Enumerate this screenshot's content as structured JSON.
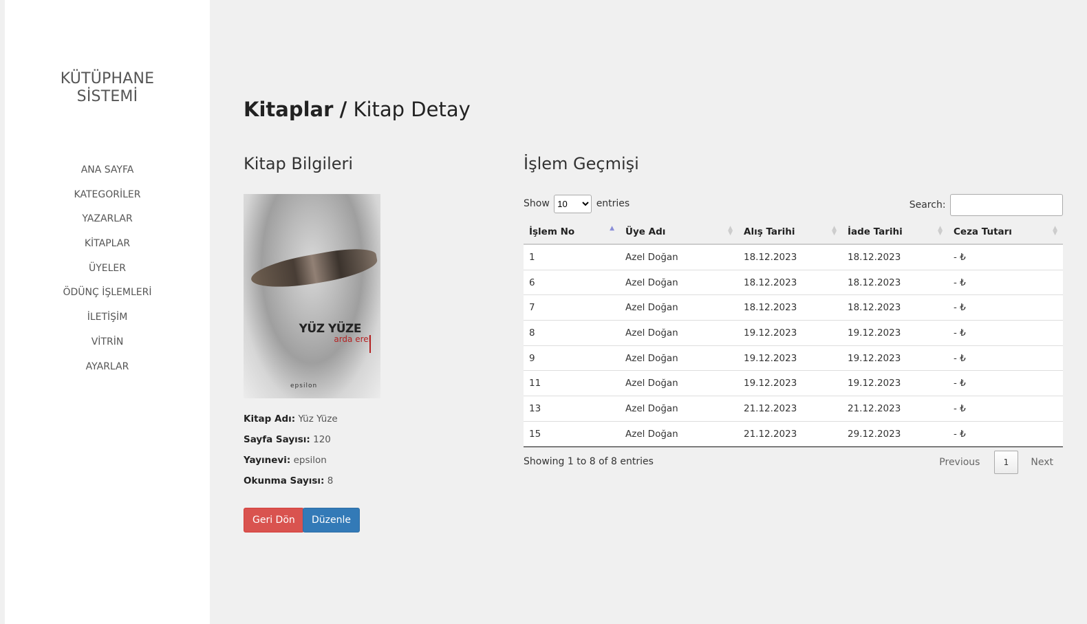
{
  "sidebar": {
    "brand_line1": "KÜTÜPHANE",
    "brand_line2": "SİSTEMİ",
    "items": [
      {
        "label": "ANA SAYFA"
      },
      {
        "label": "KATEGORİLER"
      },
      {
        "label": "YAZARLAR"
      },
      {
        "label": "KİTAPLAR"
      },
      {
        "label": "ÜYELER"
      },
      {
        "label": "ÖDÜNÇ İŞLEMLERİ"
      },
      {
        "label": "İLETİŞİM"
      },
      {
        "label": "VİTRİN"
      },
      {
        "label": "AYARLAR"
      }
    ]
  },
  "header": {
    "breadcrumb_root": "Kitaplar",
    "separator": "/",
    "breadcrumb_current": "Kitap Detay"
  },
  "book": {
    "section_title": "Kitap Bilgileri",
    "cover": {
      "title": "YÜZ YÜZE",
      "author": "arda erel",
      "publisher_logo": "epsilon"
    },
    "fields": [
      {
        "label": "Kitap Adı:",
        "value": "Yüz Yüze"
      },
      {
        "label": "Sayfa Sayısı:",
        "value": "120"
      },
      {
        "label": "Yayınevi:",
        "value": "epsilon"
      },
      {
        "label": "Okunma Sayısı:",
        "value": "8"
      }
    ],
    "back_button": "Geri Dön",
    "edit_button": "Düzenle"
  },
  "history": {
    "section_title": "İşlem Geçmişi",
    "show_label": "Show",
    "entries_label": "entries",
    "page_length": "10",
    "search_label": "Search:",
    "search_value": "",
    "columns": [
      "İşlem No",
      "Üye Adı",
      "Alış Tarihi",
      "İade Tarihi",
      "Ceza Tutarı"
    ],
    "rows": [
      [
        "1",
        "Azel Doğan",
        "18.12.2023",
        "18.12.2023",
        "- ₺"
      ],
      [
        "6",
        "Azel Doğan",
        "18.12.2023",
        "18.12.2023",
        "- ₺"
      ],
      [
        "7",
        "Azel Doğan",
        "18.12.2023",
        "18.12.2023",
        "- ₺"
      ],
      [
        "8",
        "Azel Doğan",
        "19.12.2023",
        "19.12.2023",
        "- ₺"
      ],
      [
        "9",
        "Azel Doğan",
        "19.12.2023",
        "19.12.2023",
        "- ₺"
      ],
      [
        "11",
        "Azel Doğan",
        "19.12.2023",
        "19.12.2023",
        "- ₺"
      ],
      [
        "13",
        "Azel Doğan",
        "21.12.2023",
        "21.12.2023",
        "- ₺"
      ],
      [
        "15",
        "Azel Doğan",
        "21.12.2023",
        "29.12.2023",
        "- ₺"
      ]
    ],
    "info_text": "Showing 1 to 8 of 8 entries",
    "previous_label": "Previous",
    "current_page": "1",
    "next_label": "Next"
  }
}
